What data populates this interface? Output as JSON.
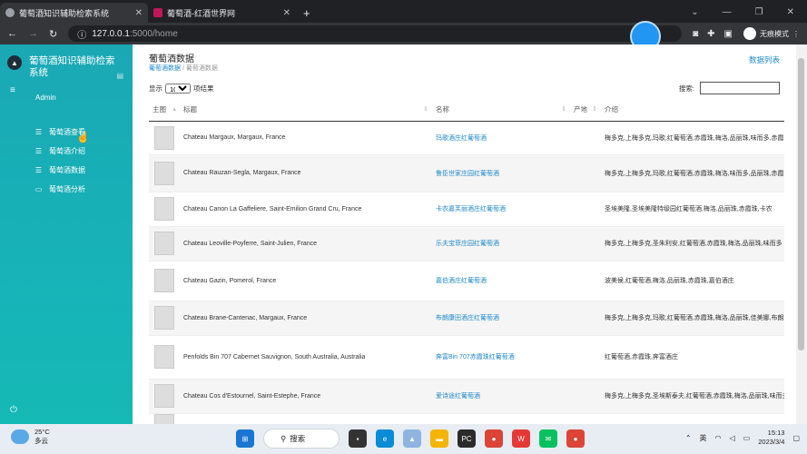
{
  "browser": {
    "tabs": [
      {
        "title": "葡萄酒知识辅助检索系统",
        "active": true
      },
      {
        "title": "葡萄酒-红酒世界网",
        "active": false
      }
    ],
    "url_host": "127.0.0.1",
    "url_path": ":5000/home",
    "profile_label": "无痕模式"
  },
  "sidebar": {
    "title": "葡萄酒知识辅助检索系统",
    "user": "Admin",
    "items": [
      {
        "label": "葡萄酒查看",
        "icon": "list-icon"
      },
      {
        "label": "葡萄酒介绍",
        "icon": "list-icon"
      },
      {
        "label": "葡萄酒数据",
        "icon": "list-icon"
      },
      {
        "label": "葡萄酒分析",
        "icon": "card-icon"
      }
    ]
  },
  "main": {
    "title": "葡萄酒数据",
    "breadcrumb": [
      "葡萄酒数据",
      "葡萄酒数据"
    ],
    "breadcrumb_sep": "/",
    "data_list_link": "数据列表",
    "show_label": "显示",
    "page_size": "10",
    "entries_label": "项结果",
    "search_label": "搜索:",
    "columns": [
      "主图",
      "标题",
      "名称",
      "产地",
      "介绍"
    ],
    "rows": [
      {
        "title": "Chateau Margaux, Margaux, France",
        "name": "玛歌酒庄红葡萄酒",
        "origin": "",
        "intro": "梅多克,上梅多克,玛歌,红葡萄酒,赤霞珠,梅洛,品丽珠,味而多,赤霞珠"
      },
      {
        "title": "Chateau Rauzan-Segla, Margaux, France",
        "name": "鲁臣世家庄园红葡萄酒",
        "origin": "",
        "intro": "梅多克,上梅多克,玛歌,红葡萄酒,赤霞珠,梅洛,味而多,品丽珠,赤霞珠"
      },
      {
        "title": "Chateau Canon La Gaffeliere, Saint-Emilion Grand Cru, France",
        "name": "卡农嘉芙丽酒庄红葡萄酒",
        "origin": "",
        "intro": "圣埃美隆,圣埃美隆特级园红葡萄酒,梅洛,品丽珠,赤霞珠,卡农"
      },
      {
        "title": "Chateau Leoville-Poyferre, Saint-Julien, France",
        "name": "乐夫宝菲庄园红葡萄酒",
        "origin": "",
        "intro": "梅多克,上梅多克,圣朱利安,红葡萄酒,赤霞珠,梅洛,品丽珠,味而多"
      },
      {
        "title": "Chateau Gazin, Pomerol, France",
        "name": "嘉伯酒庄红葡萄酒",
        "origin": "",
        "intro": "波美侯,红葡萄酒,梅洛,品丽珠,赤霞珠,嘉伯酒庄"
      },
      {
        "title": "Chateau Brane-Cantenac, Margaux, France",
        "name": "布朗康田酒庄红葡萄酒",
        "origin": "",
        "intro": "梅多克,上梅多克,玛歌,红葡萄酒,赤霞珠,梅洛,品丽珠,佳美娜,布朗"
      },
      {
        "title": "Penfolds Bin 707 Cabernet Sauvignon, South Australia, Australia",
        "name": "奔富Bin 707赤霞珠红葡萄酒",
        "origin": "",
        "intro": "红葡萄酒,赤霞珠,奔富酒庄"
      },
      {
        "title": "Chateau Cos d'Estournel, Saint-Estephe, France",
        "name": "爱诗途红葡萄酒",
        "origin": "",
        "intro": "梅多克,上梅多克,圣埃斯泰夫,红葡萄酒,赤霞珠,梅洛,品丽珠,味而多"
      },
      {
        "title": "",
        "name": "",
        "origin": "",
        "intro": ""
      }
    ]
  },
  "taskbar": {
    "temperature": "25°C",
    "weather": "多云",
    "search_label": "搜索",
    "ime": "英",
    "time": "15:13",
    "date": "2023/3/4"
  },
  "colors": {
    "sidebar": "#17b3b8",
    "link": "#1e88c7",
    "browser_dark": "#202124"
  }
}
